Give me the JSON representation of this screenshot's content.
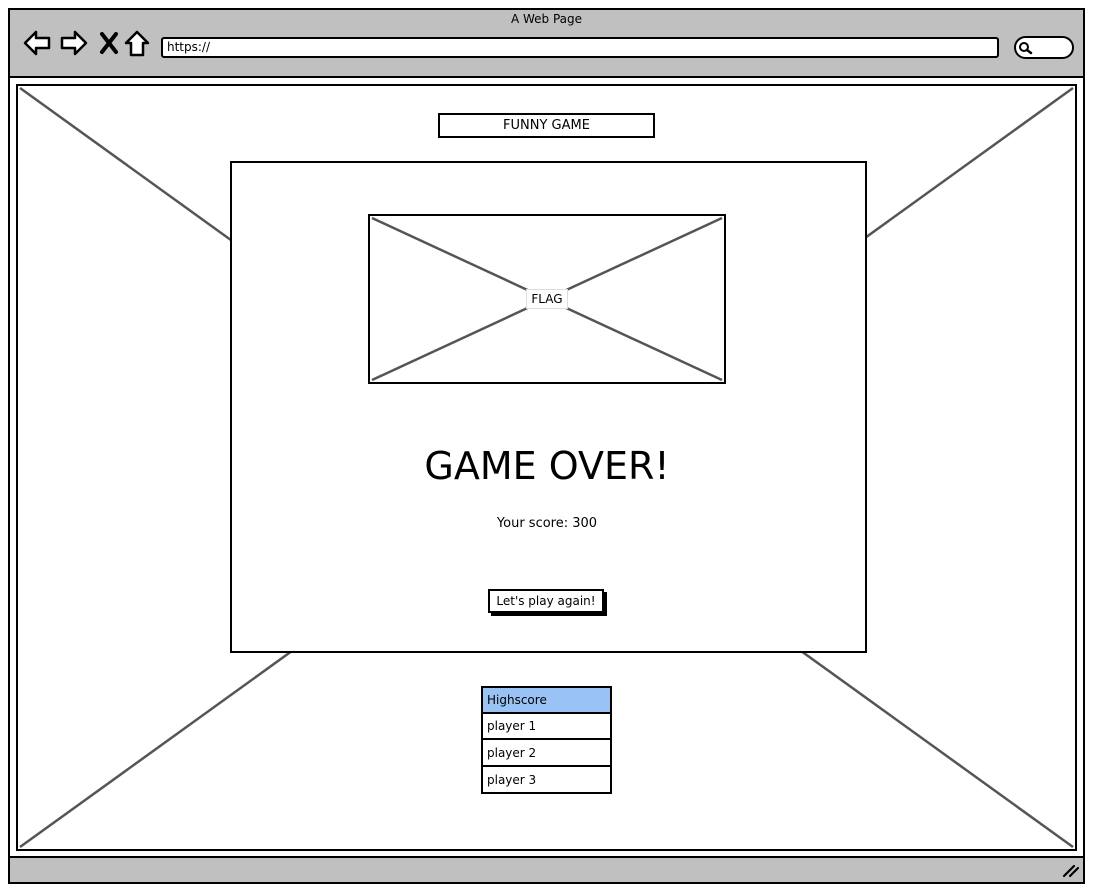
{
  "browser": {
    "title": "A Web Page",
    "url": "https://"
  },
  "page": {
    "game_title": "FUNNY GAME",
    "flag_label": "FLAG",
    "heading": "GAME OVER!",
    "score_label": "Your score:",
    "score_value": "300",
    "play_again_label": "Let's play again!"
  },
  "highscore": {
    "header": "Highscore",
    "players": [
      "player 1",
      "player 2",
      "player 3"
    ]
  },
  "colors": {
    "chrome_gray": "#c0c0c0",
    "highscore_header": "#99c2f5",
    "placeholder_line": "#555555"
  },
  "icons": {
    "nav": [
      "back-arrow-icon",
      "forward-arrow-icon",
      "close-x-icon",
      "home-icon"
    ],
    "search": "search-icon",
    "resize": "resize-grip-icon"
  }
}
